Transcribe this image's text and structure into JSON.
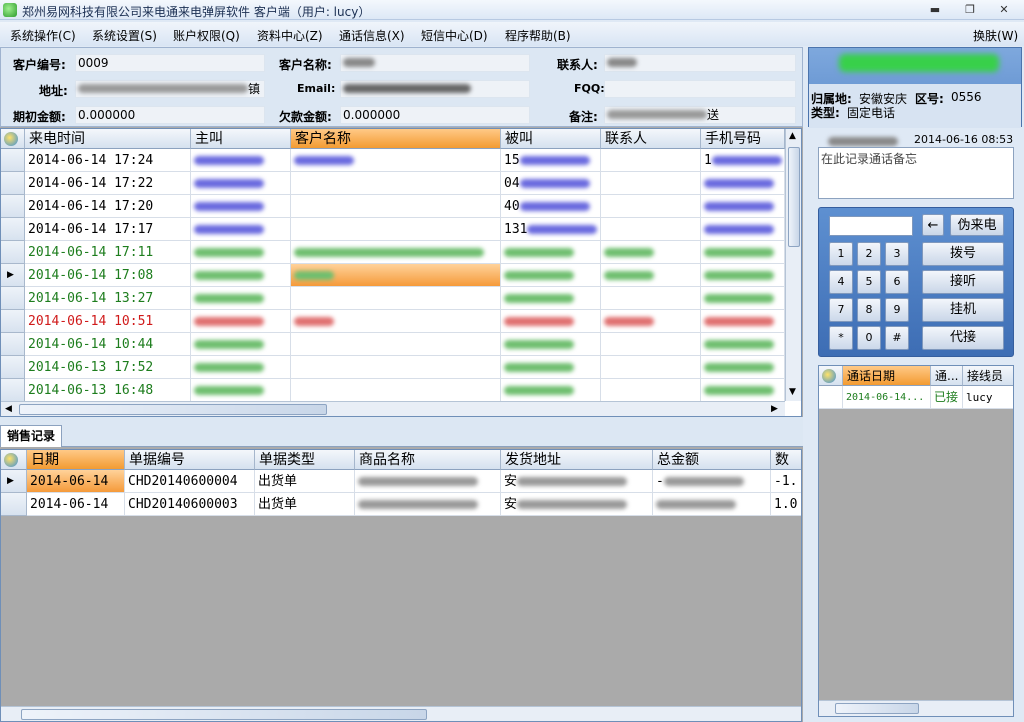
{
  "window": {
    "title": "郑州易网科技有限公司来电通来电弹屏软件  客户端（用户: lucy）",
    "min": "▬",
    "max": "❐",
    "close": "✕"
  },
  "menu": {
    "items": [
      "系统操作(C)",
      "系统设置(S)",
      "账户权限(Q)",
      "资料中心(Z)",
      "通话信息(X)",
      "短信中心(D)",
      "程序帮助(B)"
    ],
    "skin": "换肤(W)"
  },
  "customer_form": {
    "code_label": "客户编号:",
    "code_value": "0009",
    "name_label": "客户名称:",
    "contact_label": "联系人:",
    "address_label": "地址:",
    "address_tail": "镇",
    "email_label": "Email:",
    "fqq_label": "FQQ:",
    "opening_label": "期初金额:",
    "opening_value": "0.000000",
    "arrears_label": "欠款金额:",
    "arrears_value": "0.000000",
    "remark_label": "备注:",
    "remark_tail": "送"
  },
  "calls_grid": {
    "columns": [
      "来电时间",
      "主叫",
      "客户名称",
      "被叫",
      "联系人",
      "手机号码"
    ],
    "rows": [
      {
        "time": "2014-06-14 17:24",
        "color": "#000000",
        "called_prefix": "15",
        "mobile_prefix": "1"
      },
      {
        "time": "2014-06-14 17:22",
        "color": "#000000",
        "called_prefix": "04",
        "mobile_prefix": ""
      },
      {
        "time": "2014-06-14 17:20",
        "color": "#000000",
        "called_prefix": "40",
        "mobile_prefix": ""
      },
      {
        "time": "2014-06-14 17:17",
        "color": "#000000",
        "called_prefix": "131",
        "mobile_prefix": ""
      },
      {
        "time": "2014-06-14 17:11",
        "color": "#1d7d1d",
        "called_prefix": "",
        "mobile_prefix": ""
      },
      {
        "time": "2014-06-14 17:08",
        "color": "#1d7d1d",
        "called_prefix": "",
        "mobile_prefix": "",
        "selected": true
      },
      {
        "time": "2014-06-14 13:27",
        "color": "#1d7d1d",
        "called_prefix": "",
        "mobile_prefix": ""
      },
      {
        "time": "2014-06-14 10:51",
        "color": "#d01a1a",
        "called_prefix": "",
        "mobile_prefix": ""
      },
      {
        "time": "2014-06-14 10:44",
        "color": "#1d7d1d",
        "called_prefix": "",
        "mobile_prefix": ""
      },
      {
        "time": "2014-06-13 17:52",
        "color": "#1d7d1d",
        "called_prefix": "",
        "mobile_prefix": ""
      },
      {
        "time": "2014-06-13 16:48",
        "color": "#1d7d1d",
        "called_prefix": "",
        "mobile_prefix": ""
      }
    ]
  },
  "sales": {
    "tab": "销售记录",
    "columns": [
      "日期",
      "单据编号",
      "单据类型",
      "商品名称",
      "发货地址",
      "总金额",
      "数量"
    ],
    "rows": [
      {
        "date": "2014-06-14",
        "no": "CHD20140600004",
        "type": "出货单",
        "addr": "安",
        "amount": "-",
        "qty": "-1."
      },
      {
        "date": "2014-06-14",
        "no": "CHD20140600003",
        "type": "出货单",
        "addr": "安",
        "amount": "",
        "qty": "1.0"
      }
    ]
  },
  "caller_info": {
    "region_label": "归属地:",
    "region_value": "安徽安庆",
    "area_label": "区号:",
    "area_value": "0556",
    "type_label": "类型:",
    "type_value": "固定电话"
  },
  "note": {
    "datetime": "2014-06-16 08:53",
    "placeholder": "在此记录通话备忘"
  },
  "dialpad": {
    "keys": [
      "1",
      "2",
      "3",
      "4",
      "5",
      "6",
      "7",
      "8",
      "9",
      "*",
      "0",
      "#"
    ],
    "backspace": "←",
    "fake_call": "伪来电",
    "dial": "拨号",
    "answer": "接听",
    "hangup": "挂机",
    "pickup": "代接"
  },
  "history": {
    "columns": [
      "通话日期",
      "通...",
      "接线员"
    ],
    "rows": [
      {
        "date": "2014-06-14...",
        "status": "已接",
        "operator": "lucy"
      }
    ]
  }
}
